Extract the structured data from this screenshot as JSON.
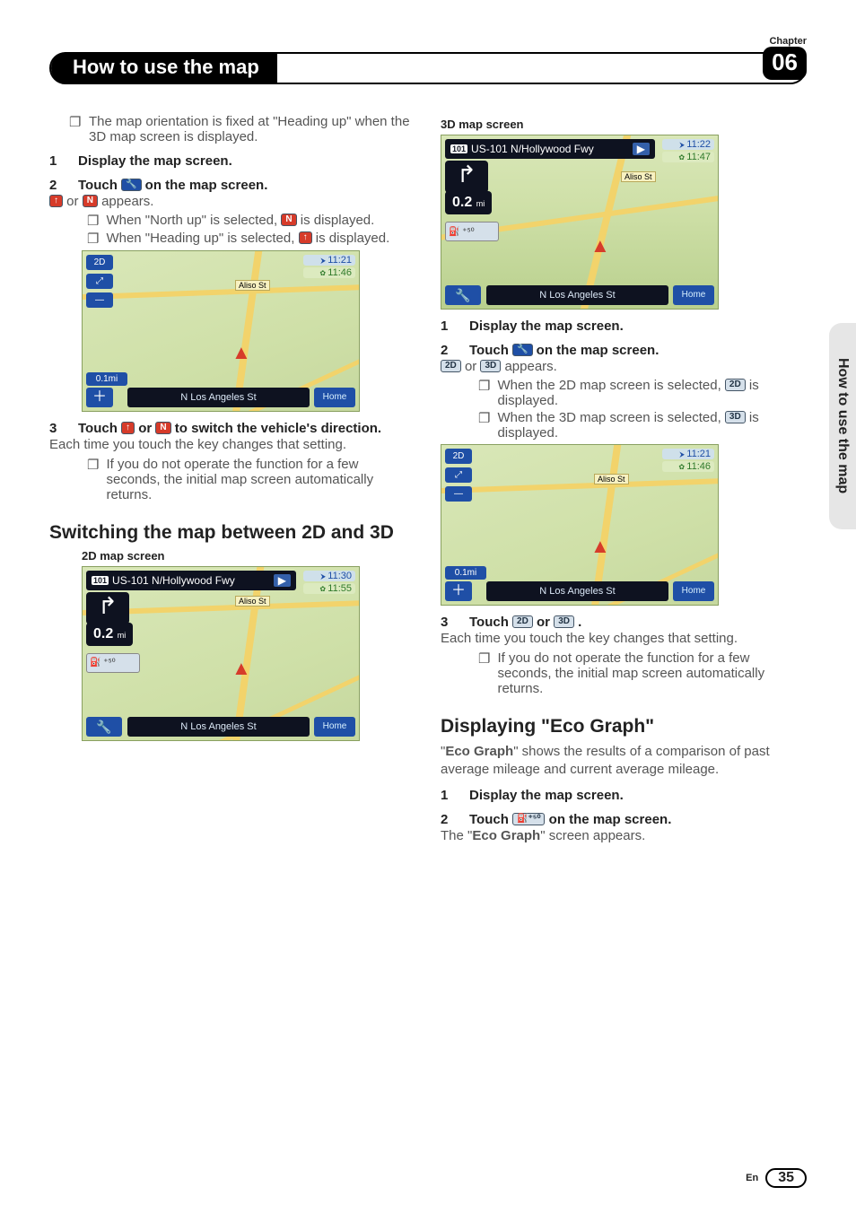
{
  "header": {
    "chapter_label": "Chapter",
    "chapter_num": "06",
    "title": "How to use the map",
    "side_tab": "How to use the map"
  },
  "footer": {
    "lang": "En",
    "page": "35"
  },
  "icons": {
    "tool": "🔧",
    "heading_up": "↑",
    "north_up": "N",
    "b2d": "2D",
    "b3d": "3D",
    "eco": "⛽⁺⁵⁰"
  },
  "nav": {
    "top_route": "US-101 N/Hollywood Fwy",
    "shield": "101",
    "play": "▶",
    "aliso": "Aliso St",
    "marker": "▲",
    "bottom": "N Los Angeles St",
    "home": "Home",
    "turn": "↱",
    "tool": "🔧",
    "left_btns": {
      "b2d": "2D",
      "z": "⤢",
      "minus": "—"
    },
    "scale": "0.1mi",
    "plus": "＋",
    "dist": "0.2",
    "dist_unit": "mi",
    "eco_btn": "⛽ ⁺⁵⁰",
    "times": {
      "a": "11:21",
      "b": "11:46",
      "c": "11:30",
      "d": "11:55",
      "e": "11:22",
      "f": "11:47"
    }
  },
  "left": {
    "intro_bullet": "The map orientation is fixed at \"Heading up\" when the 3D map screen is displayed.",
    "s1": "Display the map screen.",
    "s2a": "Touch ",
    "s2b": " on the map screen.",
    "appears_a": " or ",
    "appears_b": " appears.",
    "note_n1": "When \"North up\" is selected, ",
    "note_n2": " is displayed.",
    "note_h1": "When \"Heading up\" is selected, ",
    "note_h2": " is displayed.",
    "s3a": "Touch ",
    "s3b": " or ",
    "s3c": " to switch the vehicle's direction.",
    "s3_body": "Each time you touch the key changes that setting.",
    "s3_note": "If you do not operate the function for a few seconds, the initial map screen automatically returns.",
    "h2": "Switching the map between 2D and 3D",
    "cap2d": "2D map screen"
  },
  "right": {
    "cap3d": "3D map screen",
    "s1": "Display the map screen.",
    "s2a": "Touch ",
    "s2b": " on the map screen.",
    "appears_a": " or ",
    "appears_b": " appears.",
    "note2d1": "When the 2D map screen is selected, ",
    "note2d2": " is displayed.",
    "note3d1": "When the 3D map screen is selected, ",
    "note3d2": " is displayed.",
    "s3a": "Touch ",
    "s3b": " or ",
    "s3c": ".",
    "s3_body": "Each time you touch the key changes that setting.",
    "s3_note": "If you do not operate the function for a few seconds, the initial map screen automatically returns.",
    "h2": "Displaying \"Eco Graph\"",
    "eco_intro_a": "\"",
    "eco_intro_bold": "Eco Graph",
    "eco_intro_b": "\" shows the results of a comparison of past average mileage and current average mileage.",
    "eco_s1": "Display the map screen.",
    "eco_s2a": "Touch ",
    "eco_s2b": " on the map screen.",
    "eco_res_a": "The \"",
    "eco_res_bold": "Eco Graph",
    "eco_res_b": "\" screen appears."
  }
}
